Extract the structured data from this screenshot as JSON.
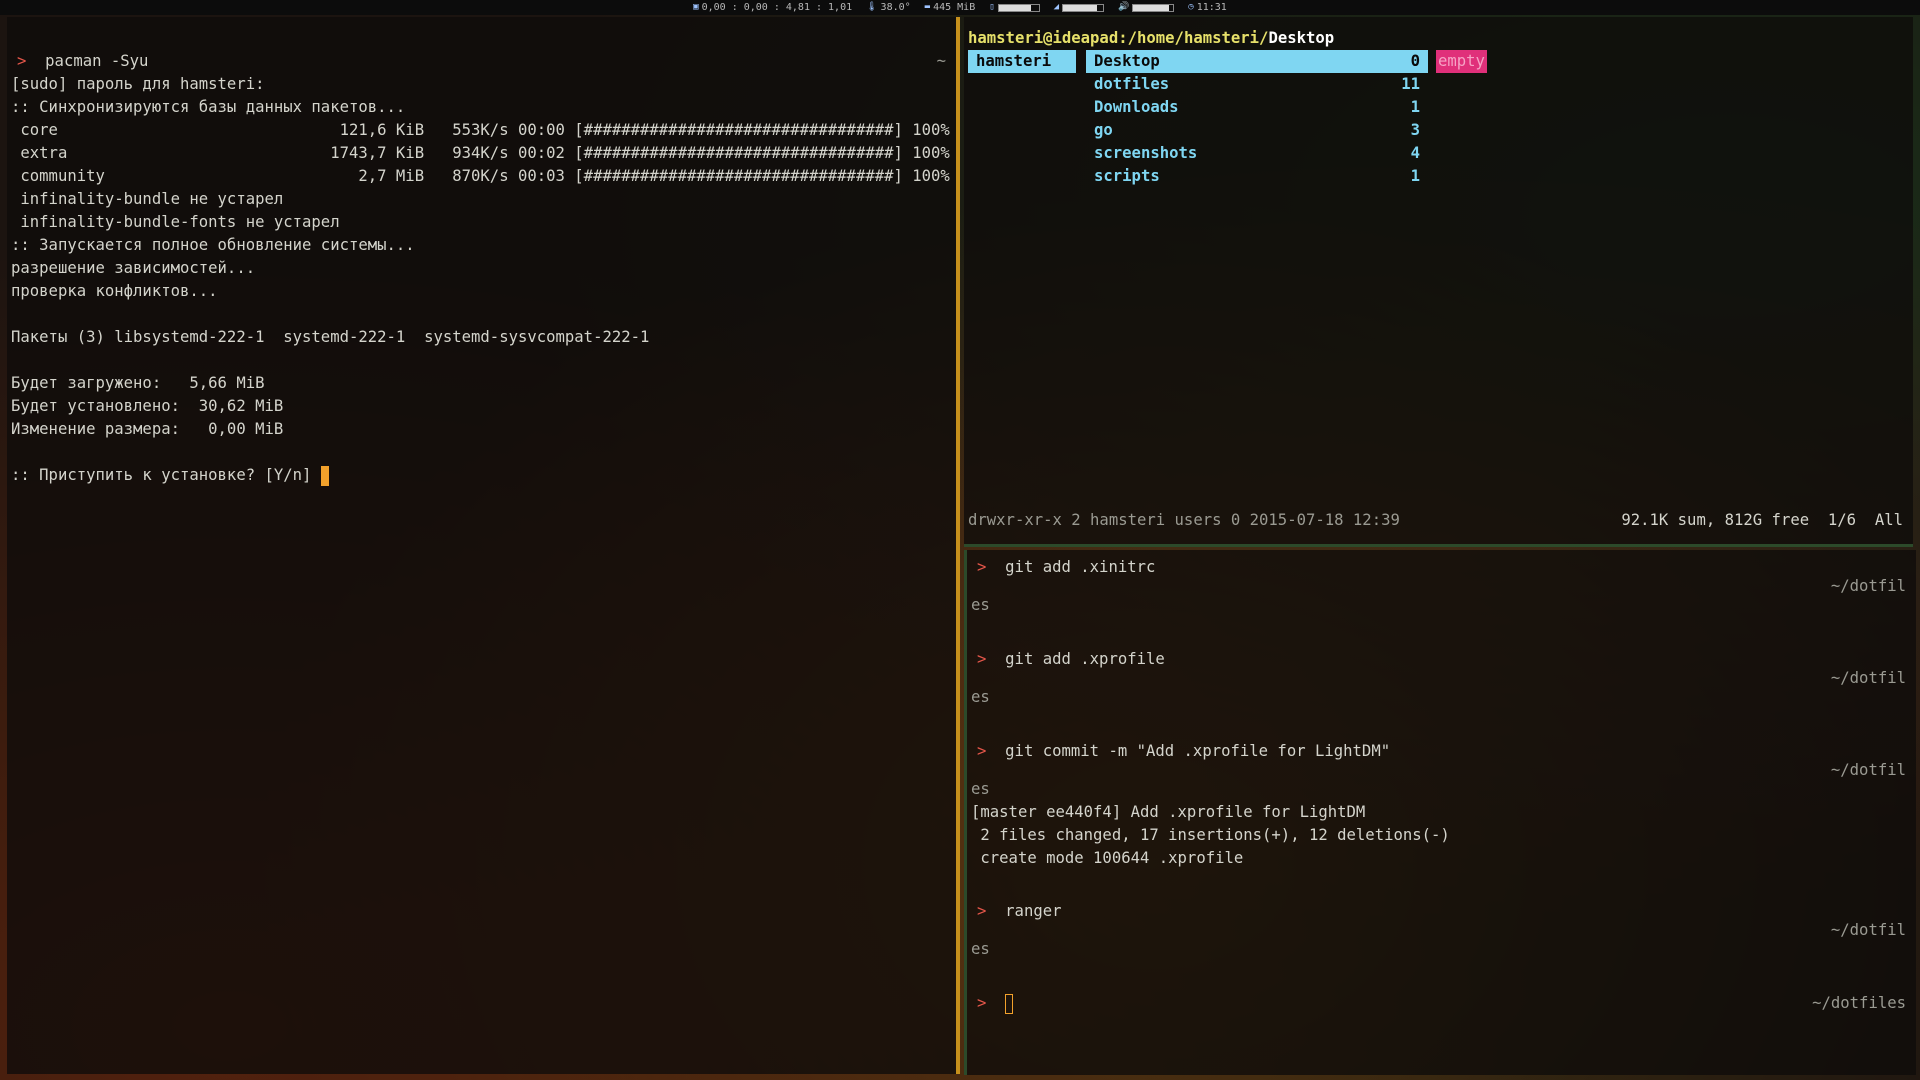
{
  "statusbar": {
    "load": "0,00 : 0,00 : 4,81 : 1,01",
    "temp": "38.0°",
    "mem": "445 MiB",
    "clock": "11:31",
    "battery_level": 0.8,
    "wifi_level": 0.85,
    "volume_level": 0.9
  },
  "left_terminal": {
    "prompt": ">",
    "command": "pacman -Syu",
    "right_marker": "~",
    "lines": [
      "[sudo] пароль для hamsteri:",
      ":: Синхронизируются базы данных пакетов...",
      " core                              121,6 KiB   553K/s 00:00 [#################################] 100%",
      " extra                            1743,7 KiB   934K/s 00:02 [#################################] 100%",
      " community                           2,7 MiB   870K/s 00:03 [#################################] 100%",
      " infinality-bundle не устарел",
      " infinality-bundle-fonts не устарел",
      ":: Запускается полное обновление системы...",
      "разрешение зависимостей...",
      "проверка конфликтов...",
      "",
      "Пакеты (3) libsystemd-222-1  systemd-222-1  systemd-sysvcompat-222-1",
      "",
      "Будет загружено:   5,66 MiB",
      "Будет установлено:  30,62 MiB",
      "Изменение размера:   0,00 MiB",
      "",
      ":: Приступить к установке? [Y/n] "
    ]
  },
  "ranger": {
    "path_user_host": "hamsteri@ideapad:",
    "path_dir": "/home/hamsteri/",
    "path_current": "Desktop",
    "parent_entry": "hamsteri",
    "entries": [
      {
        "name": "Desktop",
        "count": "0"
      },
      {
        "name": "dotfiles",
        "count": "11"
      },
      {
        "name": "Downloads",
        "count": "1"
      },
      {
        "name": "go",
        "count": "3"
      },
      {
        "name": "screenshots",
        "count": "4"
      },
      {
        "name": "scripts",
        "count": "1"
      }
    ],
    "preview": "empty",
    "footer_left": "drwxr-xr-x 2 hamsteri users 0 2015-07-18 12:39",
    "footer_right": "92.1K sum, 812G free  1/6  All"
  },
  "git_terminal": {
    "prompt": ">",
    "dir_marker": "~/dotfil",
    "dir_marker_wrap": "es",
    "current_dir": "~/dotfiles",
    "cmd1": "git add .xinitrc",
    "cmd2": "git add .xprofile",
    "cmd3": "git commit -m \"Add .xprofile for LightDM\"",
    "commit_out1": "[master ee440f4] Add .xprofile for LightDM",
    "commit_out2": " 2 files changed, 17 insertions(+), 12 deletions(-)",
    "commit_out3": " create mode 100644 .xprofile",
    "cmd4": "ranger"
  }
}
